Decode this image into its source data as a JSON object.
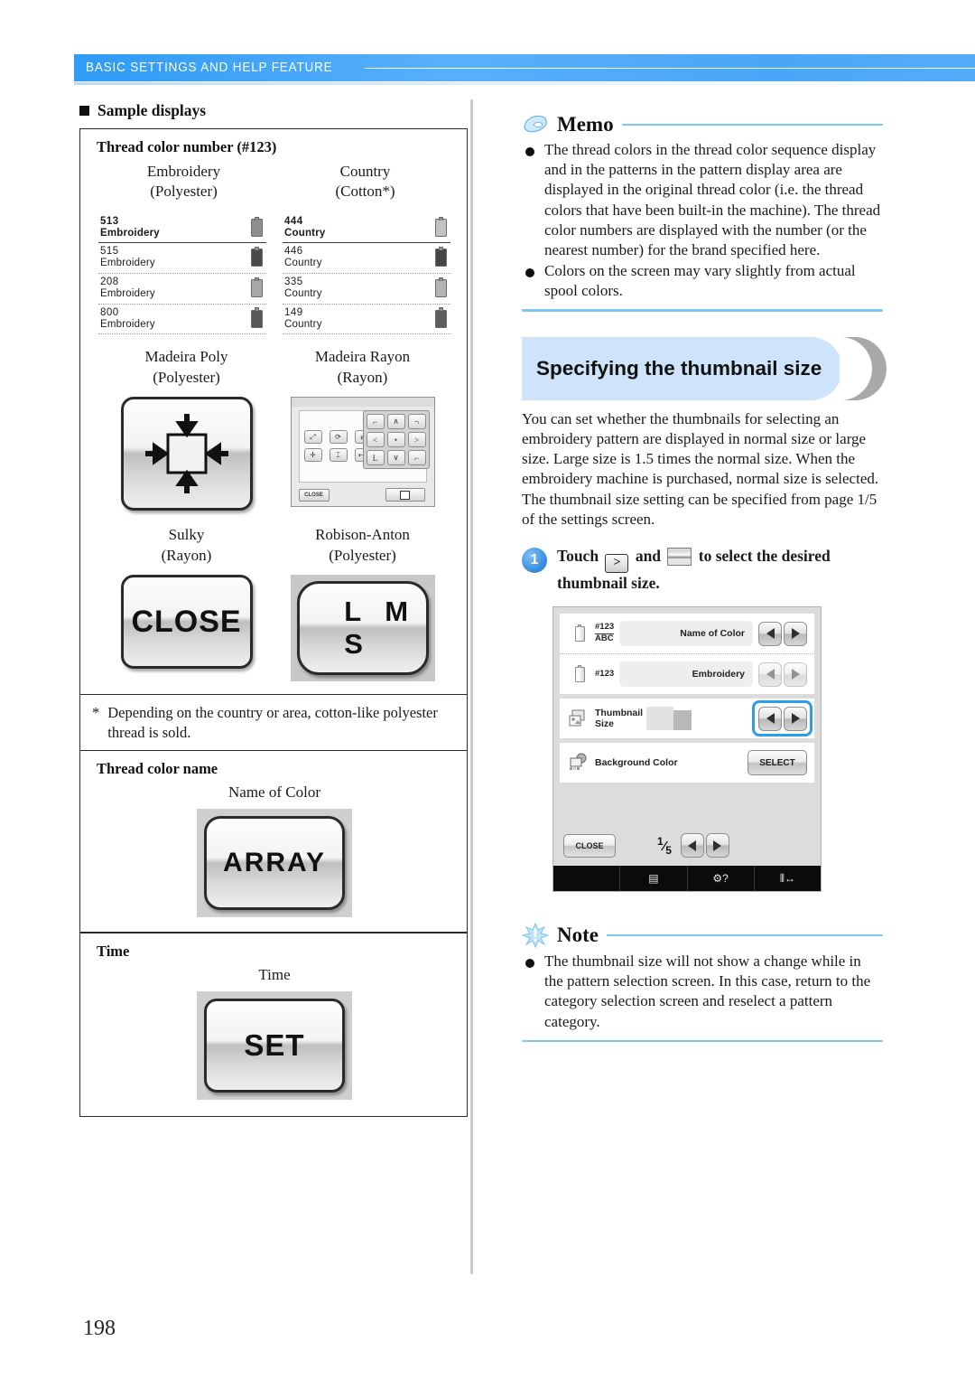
{
  "header": {
    "title": "BASIC SETTINGS AND HELP FEATURE"
  },
  "page_number": "198",
  "left": {
    "section_title": "Sample displays",
    "thread_number_box": {
      "heading": "Thread color number (#123)",
      "columns": [
        {
          "brand": "Embroidery",
          "material": "(Polyester)"
        },
        {
          "brand": "Country",
          "material": "(Cotton*)"
        }
      ],
      "list_left": [
        {
          "number": "513",
          "name": "Embroidery",
          "swatch": "#8e8e8e"
        },
        {
          "number": "515",
          "name": "Embroidery",
          "swatch": "#4a4a4a"
        },
        {
          "number": "208",
          "name": "Embroidery",
          "swatch": "#a9a9a9"
        },
        {
          "number": "800",
          "name": "Embroidery",
          "swatch": "#575757"
        }
      ],
      "list_right": [
        {
          "number": "444",
          "name": "Country",
          "swatch": "#c2c2c2"
        },
        {
          "number": "446",
          "name": "Country",
          "swatch": "#454545"
        },
        {
          "number": "335",
          "name": "Country",
          "swatch": "#b5b5b5"
        },
        {
          "number": "149",
          "name": "Country",
          "swatch": "#5e5e5e"
        }
      ],
      "samples_row2": [
        {
          "brand": "Madeira Poly",
          "material": "(Polyester)",
          "image": "move-pattern-button"
        },
        {
          "brand": "Madeira Rayon",
          "material": "(Rayon)",
          "image": "arrow-pad-screen"
        }
      ],
      "samples_row3": [
        {
          "brand": "Sulky",
          "material": "(Rayon)",
          "image": "close-button",
          "label": "CLOSE"
        },
        {
          "brand": "Robison-Anton",
          "material": "(Polyester)",
          "image": "lms-button",
          "label": "L M S"
        }
      ],
      "footnote_marker": "*",
      "footnote": "Depending on the country or area, cotton-like polyester thread is sold."
    },
    "thread_name_box": {
      "heading": "Thread color name",
      "caption": "Name of Color",
      "button_label": "ARRAY"
    },
    "time_box": {
      "heading": "Time",
      "caption": "Time",
      "button_label": "SET"
    }
  },
  "right": {
    "memo": {
      "title": "Memo",
      "bullets": [
        "The thread colors in the thread color sequence display and in the patterns in the pattern display area are displayed in the original thread color (i.e. the thread colors that have been built-in the machine). The thread color numbers are displayed with the number (or the nearest number) for the brand specified here.",
        "Colors on the screen may vary slightly from actual spool colors."
      ]
    },
    "section": {
      "title": "Specifying the thumbnail size",
      "paragraph1": "You can set whether the thumbnails for selecting an embroidery pattern are displayed in normal size or large size. Large size is 1.5 times the normal size. When the embroidery machine is purchased, normal size is selected.",
      "paragraph2": "The thumbnail size setting can be specified from page 1/5 of the settings screen."
    },
    "step1": {
      "number": "1",
      "prefix": "Touch",
      "key1": ">",
      "mid": "and",
      "suffix": "to select the desired thumbnail size."
    },
    "screen": {
      "rows": [
        {
          "icon": "spool-abc-icon",
          "icon_label_top": "#123",
          "icon_label_bottom": "ABC",
          "value": "Name of Color",
          "control": "arrows",
          "dim": false
        },
        {
          "icon": "spool-icon",
          "icon_label_top": "#123",
          "icon_label_bottom": "",
          "value": "Embroidery",
          "control": "arrows",
          "dim": true
        },
        {
          "icon": "thumbnail-size-icon",
          "label": "Thumbnail Size",
          "value": "",
          "control": "arrows",
          "highlighted": true
        },
        {
          "icon": "background-color-icon",
          "label": "Background Color",
          "control": "select",
          "button_label": "SELECT"
        }
      ],
      "close_label": "CLOSE",
      "page_indicator_num": "1",
      "page_indicator_den": "5",
      "taskbar": [
        "",
        "list-icon",
        "presser-foot-help-icon",
        "stitch-width-icon"
      ]
    },
    "note": {
      "title": "Note",
      "bullets": [
        "The thumbnail size will not show a change while in the pattern selection screen. In this case, return to the category selection screen and reselect a pattern category."
      ]
    }
  },
  "colors": {
    "header_blue": "#4aa6f7",
    "banner_blue": "#cde4fa",
    "rule_blue": "#7ec8f2",
    "highlight_blue": "#2b9cf0"
  }
}
